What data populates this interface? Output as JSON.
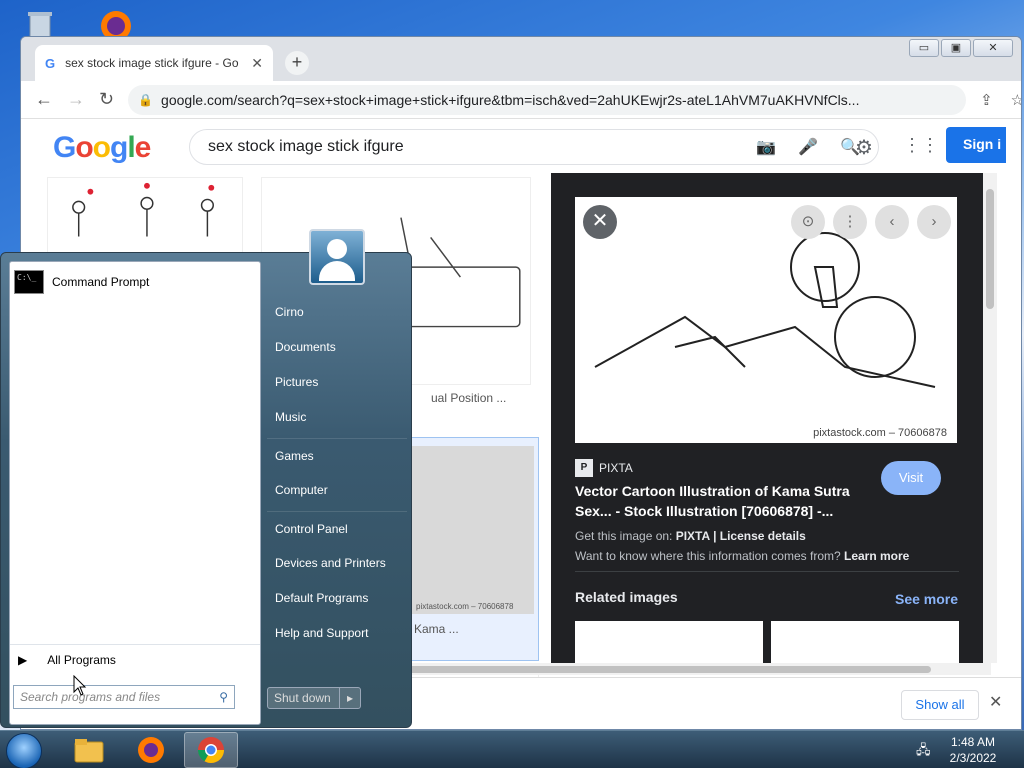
{
  "browser": {
    "tab_title": "sex stock image stick ifgure - Go",
    "tab_favicon": "G",
    "new_tab": "+",
    "url": "google.com/search?q=sex+stock+image+stick+ifgure&tbm=isch&ved=2ahUKEwjr2s-ateL1AhVM7uAKHVNfCls...",
    "win_min": "▭",
    "win_max": "▣",
    "win_close": "✕"
  },
  "google": {
    "logo": [
      "G",
      "o",
      "o",
      "g",
      "l",
      "e"
    ],
    "query": "sex stock image stick ifgure",
    "sign_in": "Sign i"
  },
  "results": {
    "caption_1": "ual Position ...",
    "caption_2": "Kama ...",
    "thumb_watermark": "pixtastock.com – 70606878"
  },
  "preview": {
    "watermark": "pixtastock.com – 70606878",
    "source": "PIXTA",
    "title": "Vector Cartoon Illustration of Kama Sutra Sex... - Stock Illustration [70606878] -...",
    "visit": "Visit",
    "get_image_prefix": "Get this image on: ",
    "get_image_source": "PIXTA",
    "get_image_sep": " | ",
    "license": "License details",
    "want_to_know": "Want to know where this information comes from? ",
    "learn_more": "Learn more",
    "related": "Related images",
    "see_more": "See more"
  },
  "downloads": {
    "show_all": "Show all"
  },
  "startmenu": {
    "pinned": [
      {
        "label": "Command Prompt"
      }
    ],
    "all_programs": "All Programs",
    "search_placeholder": "Search programs and files",
    "right_items": [
      {
        "label": "Cirno"
      },
      {
        "label": "Documents"
      },
      {
        "label": "Pictures"
      },
      {
        "label": "Music"
      },
      {
        "label": "Games"
      },
      {
        "label": "Computer"
      },
      {
        "label": "Control Panel"
      },
      {
        "label": "Devices and Printers"
      },
      {
        "label": "Default Programs"
      },
      {
        "label": "Help and Support"
      }
    ],
    "shutdown": "Shut down"
  },
  "taskbar": {
    "time": "1:48 AM",
    "date": "2/3/2022"
  }
}
